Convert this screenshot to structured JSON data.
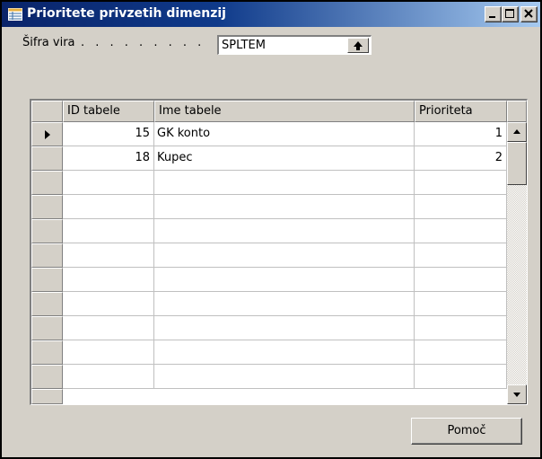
{
  "window": {
    "title": "Prioritete privzetih dimenzij",
    "title_icon": "form-icon",
    "controls": [
      "minimize-icon",
      "maximize-icon",
      "close-icon"
    ]
  },
  "filter": {
    "label": "Šifra vira",
    "dots": ". . . . . . . . .",
    "value": "SPLTEM",
    "lookup_icon": "arrow-up-lookup-icon"
  },
  "table": {
    "columns": [
      "ID tabele",
      "Ime tabele",
      "Prioriteta"
    ],
    "rows": [
      {
        "id": "15",
        "name": "GK konto",
        "priority": "1",
        "selected": true
      },
      {
        "id": "18",
        "name": "Kupec",
        "priority": "2",
        "selected": false
      }
    ],
    "empty_rows": 9,
    "selected_row_icon": "row-pointer-icon"
  },
  "buttons": {
    "help": "Pomoč"
  },
  "colors": {
    "titlebar_start": "#0a246a",
    "titlebar_end": "#a6caf0",
    "face": "#d4d0c8"
  }
}
